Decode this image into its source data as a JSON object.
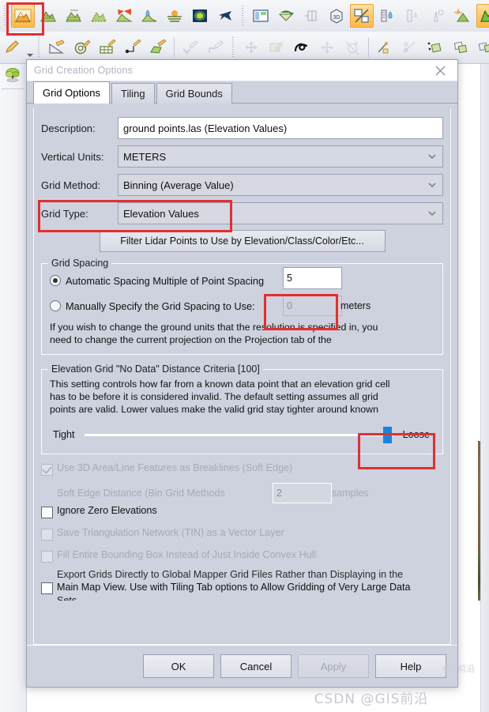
{
  "app": {
    "toolbar_rows": [
      {
        "name": "terrain-toolbar",
        "buttons": [
          {
            "icon": "mountain-orange-icon",
            "active": true
          },
          {
            "icon": "mountain-contour-icon",
            "active": false
          },
          {
            "icon": "mountain-grid-icon",
            "active": false
          },
          {
            "icon": "mountain-dashed-icon",
            "active": false
          },
          {
            "icon": "viewshed-cone-icon",
            "active": false
          },
          {
            "icon": "water-drop-terrain-icon",
            "active": false
          },
          {
            "icon": "sunrise-terrain-icon",
            "active": false
          },
          {
            "icon": "color-ramp-icon",
            "active": false
          },
          {
            "icon": "airplane-path-icon",
            "active": false
          },
          {
            "icon": "layout-panels-icon",
            "active": false
          },
          {
            "icon": "swap-arrows-icon",
            "active": false
          },
          {
            "icon": "cross-section-icon",
            "active": false
          },
          {
            "icon": "cube-3d-icon",
            "active": false
          },
          {
            "icon": "percent-slope-icon",
            "active": true
          },
          {
            "icon": "water-level-rise-icon",
            "active": false
          },
          {
            "icon": "water-level-icon",
            "active": false
          },
          {
            "icon": "weather-tower-icon",
            "active": false
          },
          {
            "icon": "sun-shadow-icon",
            "active": false
          },
          {
            "icon": "green-mountain-icon",
            "active": true
          }
        ]
      },
      {
        "name": "digitizer-toolbar",
        "buttons": [
          {
            "icon": "pencil-edit-icon",
            "active": false
          },
          {
            "icon": "measure-angle-icon",
            "active": false
          },
          {
            "icon": "target-circle-icon",
            "active": false
          },
          {
            "icon": "grid-table-icon",
            "active": false
          },
          {
            "icon": "path-node-icon",
            "active": false
          },
          {
            "icon": "area-polygon-icon",
            "active": false
          },
          {
            "icon": "check-pencil-icon",
            "active": false
          },
          {
            "icon": "corner-pencil-icon",
            "active": false
          },
          {
            "icon": "pan-move-icon",
            "active": false
          },
          {
            "icon": "rectangle-arrow-icon",
            "active": false
          },
          {
            "icon": "lasso-select-icon",
            "active": false
          },
          {
            "icon": "move-feature-icon",
            "active": false
          },
          {
            "icon": "rotate-feature-icon",
            "active": false
          },
          {
            "icon": "add-vertex-icon",
            "active": false
          },
          {
            "icon": "cut-line-icon",
            "active": false
          },
          {
            "icon": "copy-shape-icon",
            "active": false
          },
          {
            "icon": "duplicate-shape-icon",
            "active": false
          },
          {
            "icon": "stack-shape-icon",
            "active": false
          },
          {
            "icon": "multi-copy-icon",
            "active": false
          }
        ]
      }
    ],
    "left_rail": [
      {
        "icon": "tree-vegetation-icon"
      }
    ]
  },
  "dialog": {
    "title": "Grid Creation Options",
    "close_icon": "close-icon",
    "tabs": [
      {
        "label": "Grid Options",
        "selected": true
      },
      {
        "label": "Tiling",
        "selected": false
      },
      {
        "label": "Grid Bounds",
        "selected": false
      }
    ],
    "fields": [
      {
        "label": "Description:",
        "value": "ground points.las (Elevation Values)",
        "type": "text"
      },
      {
        "label": "Vertical Units:",
        "value": "METERS",
        "type": "combo"
      },
      {
        "label": "Grid Method:",
        "value": "Binning (Average Value)",
        "type": "combo"
      },
      {
        "label": "Grid Type:",
        "value": "Elevation Values",
        "type": "combo"
      }
    ],
    "filter_button": "Filter Lidar Points to Use by Elevation/Class/Color/Etc...",
    "grid_spacing": {
      "group_title": "Grid Spacing",
      "auto_label": "Automatic Spacing Multiple of Point Spacing",
      "auto_value": "5",
      "auto_selected": true,
      "manual_label": "Manually Specify the Grid Spacing to Use:",
      "manual_value": "0",
      "manual_unit": "meters",
      "manual_selected": false,
      "note_line1": "If you wish to change the ground units that the resolution is specified in, you",
      "note_line2": "need to change the current projection on the Projection tab of the"
    },
    "no_data": {
      "group_title": "Elevation Grid \"No Data\" Distance Criteria [100]",
      "desc_line1": "This setting controls how far from a known data point that an elevation grid cell",
      "desc_line2": "has to be before it is considered invalid. The default setting assumes all grid",
      "desc_line3": "points are valid. Lower values make the valid grid stay tighter around known",
      "slider_min_label": "Tight",
      "slider_max_label": "Loose",
      "slider_value": 100
    },
    "checkboxes": [
      {
        "label": "Use 3D Area/Line Features as Breaklines (Soft Edge)",
        "checked": true,
        "disabled": true,
        "indent": false
      },
      {
        "label": "Soft Edge Distance (Bin Grid Methods",
        "value": "2",
        "unit": "samples",
        "disabled": true,
        "type": "numfield"
      },
      {
        "label": "Ignore Zero Elevations",
        "checked": false,
        "disabled": false,
        "indent": false
      },
      {
        "label": "Save Triangulation Network (TIN) as a Vector Layer",
        "checked": false,
        "disabled": true,
        "indent": false
      },
      {
        "label": "Fill Entire Bounding Box Instead of Just Inside Convex Hull",
        "checked": false,
        "disabled": true,
        "indent": false
      }
    ],
    "export_checkbox": {
      "line1": "Export Grids Directly to Global Mapper Grid Files Rather than Displaying in the",
      "line2": "Main Map View. Use with Tiling Tab options to Allow Gridding of Very Large Data",
      "line3": "Sets.",
      "checked": false
    },
    "buttons": [
      {
        "label": "OK",
        "disabled": false
      },
      {
        "label": "Cancel",
        "disabled": false
      },
      {
        "label": "Apply",
        "disabled": true
      },
      {
        "label": "Help",
        "disabled": false
      }
    ]
  },
  "annotations": {
    "color": "#e03030",
    "regions": [
      "toolbar-first-button",
      "grid-type-field",
      "manual-spacing-field",
      "slider-loose-end"
    ]
  },
  "watermark": {
    "text": "CSDN @GIS前沿",
    "secondary": "GIS前沿"
  }
}
